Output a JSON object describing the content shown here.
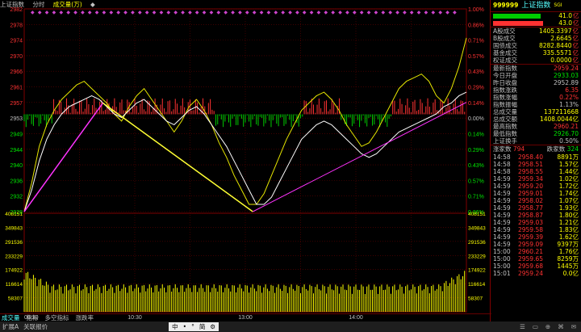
{
  "header": {
    "title": "上证指数",
    "mode": "分时",
    "volume_label": "成交量(万)",
    "diamond": "◆"
  },
  "chart_data": {
    "type": "line",
    "price_axis": [
      "2982",
      "2978",
      "2974",
      "2970",
      "2966",
      "2961",
      "2957",
      "2953",
      "2949",
      "2944",
      "2940",
      "2936",
      "2932",
      "2928"
    ],
    "pct_axis": [
      "1.00%",
      "0.86%",
      "0.71%",
      "0.57%",
      "0.43%",
      "0.29%",
      "0.14%",
      "0.00%",
      "0.14%",
      "0.29%",
      "0.43%",
      "0.57%",
      "0.71%",
      "0.86%"
    ],
    "volume_axis": [
      "408151",
      "349843",
      "291536",
      "233229",
      "174922",
      "116614",
      "58307"
    ],
    "time_labels": [
      "09:30",
      "10:30",
      "13:00",
      "14:00"
    ],
    "last_time": "15:00",
    "ylim": [
      2926.0,
      2982.0
    ],
    "prev_close": 2952.89,
    "trendline_points": [
      [
        0,
        2926.0
      ],
      [
        42,
        2956.0
      ],
      [
        122,
        2926.0
      ],
      [
        240,
        2956.2
      ]
    ],
    "index_series": [
      2926,
      2932,
      2940,
      2946,
      2950,
      2953,
      2955,
      2956,
      2957,
      2958,
      2957,
      2955,
      2953,
      2952,
      2954,
      2956,
      2957,
      2955,
      2953,
      2951,
      2950,
      2952,
      2954,
      2955,
      2953,
      2950,
      2947,
      2944,
      2940,
      2936,
      2932,
      2928,
      2928,
      2930,
      2934,
      2938,
      2942,
      2946,
      2948,
      2950,
      2951,
      2950,
      2948,
      2946,
      2944,
      2942,
      2941,
      2942,
      2944,
      2946,
      2948,
      2949,
      2950,
      2951,
      2952,
      2953,
      2955,
      2956,
      2958,
      2959
    ],
    "lead_series": [
      2926,
      2934,
      2944,
      2950,
      2954,
      2957,
      2959,
      2961,
      2962,
      2960,
      2958,
      2956,
      2953,
      2951,
      2955,
      2958,
      2960,
      2957,
      2954,
      2951,
      2948,
      2951,
      2955,
      2957,
      2954,
      2950,
      2945,
      2941,
      2936,
      2932,
      2928,
      2928,
      2931,
      2936,
      2941,
      2946,
      2950,
      2954,
      2956,
      2958,
      2959,
      2957,
      2954,
      2950,
      2947,
      2944,
      2945,
      2948,
      2952,
      2956,
      2960,
      2962,
      2963,
      2964,
      2962,
      2958,
      2956,
      2960,
      2966,
      2974
    ]
  },
  "right_panel": {
    "code": "999999",
    "name": "上证指数",
    "exch": "SGI",
    "bars": [
      {
        "value": "41.0",
        "unit": "亿",
        "color": "#00cc00",
        "fill": 0.95
      },
      {
        "value": "43.0",
        "unit": "亿",
        "color": "#ff3232",
        "fill": 1.0
      }
    ],
    "turnover": [
      {
        "k": "A股成交",
        "v": "1405.3397",
        "u": "亿"
      },
      {
        "k": "B股成交",
        "v": "2.6645",
        "u": "亿"
      },
      {
        "k": "国债成交",
        "v": "8282.8440",
        "u": "亿"
      },
      {
        "k": "基金成交",
        "v": "335.5571",
        "u": "亿"
      },
      {
        "k": "权证成交",
        "v": "0.0000",
        "u": "亿"
      }
    ],
    "stats": [
      {
        "k": "最新指数",
        "v": "2959.24",
        "c": "red"
      },
      {
        "k": "今日开盘",
        "v": "2933.03",
        "c": "green"
      },
      {
        "k": "昨日收盘",
        "v": "2952.89",
        "c": ""
      },
      {
        "k": "指数涨跌",
        "v": "6.35",
        "c": "red"
      },
      {
        "k": "指数涨幅",
        "v": "0.22%",
        "c": "red"
      },
      {
        "k": "指数振幅",
        "v": "1.13%",
        "c": ""
      },
      {
        "k": "总成交量",
        "v": "137211668",
        "c": "yel"
      },
      {
        "k": "总成交额",
        "v": "1408.0044亿",
        "c": "yel"
      },
      {
        "k": "最高指数",
        "v": "2960.21",
        "c": "red"
      },
      {
        "k": "最低指数",
        "v": "2926.70",
        "c": "green"
      },
      {
        "k": "上证换手",
        "v": "0.50%",
        "c": ""
      }
    ],
    "updown": {
      "up_label": "涨家数",
      "up": "794",
      "down_label": "跌家数",
      "down": "324"
    },
    "ticks": [
      {
        "t": "14:58",
        "p": "2958.40",
        "v": "8891万"
      },
      {
        "t": "14:58",
        "p": "2958.51",
        "v": "1.57亿"
      },
      {
        "t": "14:58",
        "p": "2958.55",
        "v": "1.44亿"
      },
      {
        "t": "14:59",
        "p": "2959.34",
        "v": "1.02亿"
      },
      {
        "t": "14:59",
        "p": "2959.20",
        "v": "1.72亿"
      },
      {
        "t": "14:59",
        "p": "2959.01",
        "v": "1.74亿"
      },
      {
        "t": "14:59",
        "p": "2958.02",
        "v": "1.07亿"
      },
      {
        "t": "14:59",
        "p": "2958.77",
        "v": "1.93亿"
      },
      {
        "t": "14:59",
        "p": "2958.87",
        "v": "1.80亿"
      },
      {
        "t": "14:59",
        "p": "2959.03",
        "v": "1.21亿"
      },
      {
        "t": "14:59",
        "p": "2959.58",
        "v": "1.83亿"
      },
      {
        "t": "14:59",
        "p": "2959.39",
        "v": "1.62亿"
      },
      {
        "t": "14:59",
        "p": "2959.09",
        "v": "9397万"
      },
      {
        "t": "15:00",
        "p": "2960.21",
        "v": "1.76亿"
      },
      {
        "t": "15:00",
        "p": "2959.65",
        "v": "8259万"
      },
      {
        "t": "15:00",
        "p": "2959.68",
        "v": "1445万"
      },
      {
        "t": "15:01",
        "p": "2959.24",
        "v": "0.0亿"
      }
    ]
  },
  "bottom_tabs": [
    "成交量",
    "指标",
    "多空指标",
    "涨跌率"
  ],
  "statusbar": {
    "left": [
      "扩展A",
      "关联报价"
    ],
    "ime": [
      "中",
      "•",
      "°",
      "简",
      "⚙"
    ],
    "tray": [
      "☰",
      "▭",
      "⊕",
      "⌘",
      "✉"
    ]
  }
}
